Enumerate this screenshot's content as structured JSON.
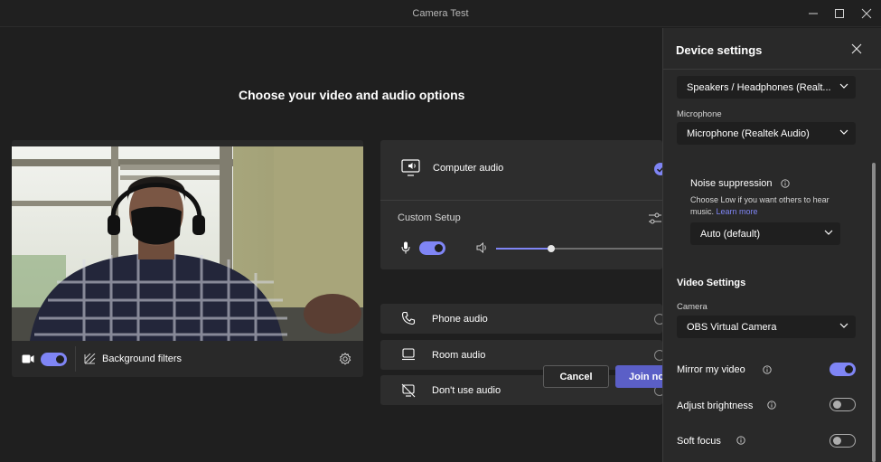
{
  "window": {
    "title": "Camera Test"
  },
  "main": {
    "heading": "Choose your video and audio options",
    "video_bar": {
      "background_filters_label": "Background filters",
      "camera_toggle_on": true
    },
    "audio": {
      "computer_audio": "Computer audio",
      "custom_setup": "Custom Setup",
      "mic_toggle_on": true,
      "volume_level_percent": 33,
      "phone_audio": "Phone audio",
      "room_audio": "Room audio",
      "dont_use_audio": "Don't use audio"
    },
    "buttons": {
      "cancel": "Cancel",
      "join": "Join now"
    }
  },
  "side": {
    "title": "Device settings",
    "speaker_value": "Speakers / Headphones (Realt...",
    "microphone_label": "Microphone",
    "microphone_value": "Microphone (Realtek Audio)",
    "noise": {
      "title": "Noise suppression",
      "desc": "Choose Low if you want others to hear music.",
      "learn_more": "Learn more",
      "value": "Auto (default)"
    },
    "video_settings_title": "Video Settings",
    "camera_label": "Camera",
    "camera_value": "OBS Virtual Camera",
    "mirror_label": "Mirror my video",
    "mirror_on": true,
    "brightness_label": "Adjust brightness",
    "brightness_on": false,
    "soft_focus_label": "Soft focus",
    "soft_focus_on": false
  },
  "colors": {
    "accent": "#7f85f5",
    "primary_button": "#5b5fc7",
    "background": "#1f1f1f",
    "panel": "#292929"
  }
}
